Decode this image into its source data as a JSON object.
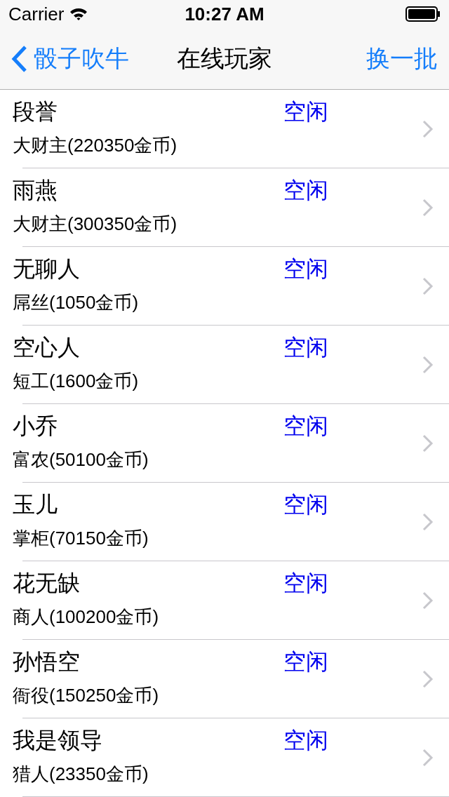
{
  "status_bar": {
    "carrier": "Carrier",
    "time": "10:27 AM"
  },
  "nav": {
    "back": "骰子吹牛",
    "title": "在线玩家",
    "action": "换一批"
  },
  "players": [
    {
      "name": "段誉",
      "status": "空闲",
      "rank": "大财主(220350金币)"
    },
    {
      "name": "雨燕",
      "status": "空闲",
      "rank": "大财主(300350金币)"
    },
    {
      "name": "无聊人",
      "status": "空闲",
      "rank": "屌丝(1050金币)"
    },
    {
      "name": "空心人",
      "status": "空闲",
      "rank": "短工(1600金币)"
    },
    {
      "name": "小乔",
      "status": "空闲",
      "rank": "富农(50100金币)"
    },
    {
      "name": "玉儿",
      "status": "空闲",
      "rank": "掌柜(70150金币)"
    },
    {
      "name": "花无缺",
      "status": "空闲",
      "rank": "商人(100200金币)"
    },
    {
      "name": "孙悟空",
      "status": "空闲",
      "rank": "衙役(150250金币)"
    },
    {
      "name": "我是领导",
      "status": "空闲",
      "rank": "猎人(23350金币)"
    }
  ]
}
